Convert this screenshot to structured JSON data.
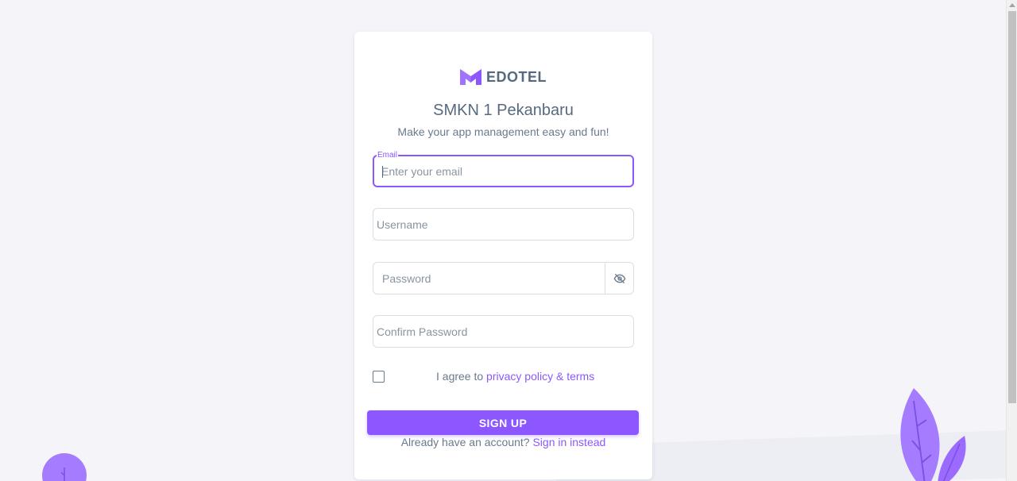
{
  "brand": {
    "name": "EDOTEL",
    "accent": "#8c57ff"
  },
  "header": {
    "title": "SMKN 1 Pekanbaru",
    "subtitle": "Make your app management easy and fun!"
  },
  "form": {
    "email": {
      "label": "Email",
      "placeholder": "Enter your email",
      "value": ""
    },
    "username": {
      "placeholder": "Username",
      "value": ""
    },
    "password": {
      "placeholder": "Password",
      "value": "",
      "toggle_icon": "eye-off-icon"
    },
    "confirm_password": {
      "placeholder": "Confirm Password",
      "value": ""
    },
    "agree": {
      "checked": false,
      "prefix": "I agree to ",
      "link_text": "privacy policy & terms"
    },
    "submit_label": "SIGN UP"
  },
  "footer": {
    "question": "Already have an account? ",
    "signin_link": "Sign in instead"
  }
}
